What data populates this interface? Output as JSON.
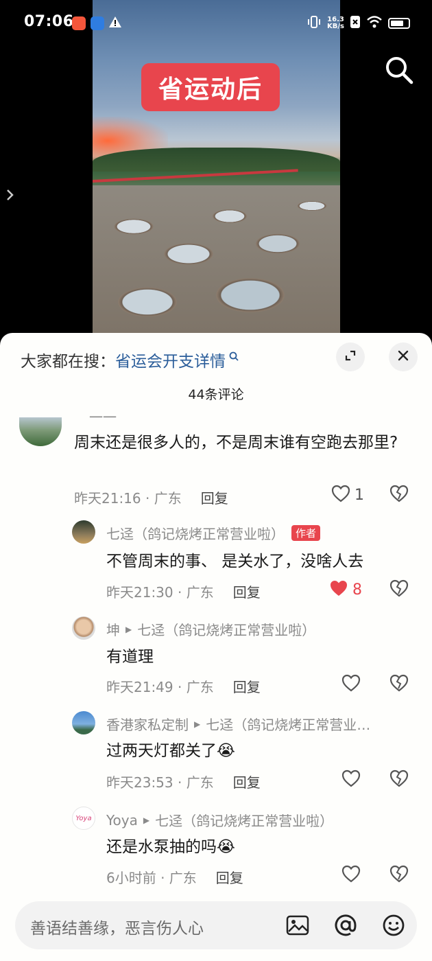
{
  "status_bar": {
    "time": "07:06",
    "net_speed_value": "16.3",
    "net_speed_unit": "KB/s"
  },
  "video": {
    "badge_text": "省运动后"
  },
  "comments_panel": {
    "hot_search_label": "大家都在搜：",
    "hot_search_term": "省运会开支详情",
    "count_label": "44条评论",
    "comments": [
      {
        "username": "一一",
        "text": "周末还是很多人的，不是周末谁有空跑去那里?",
        "time": "昨天21:16 · 广东",
        "reply_label": "回复",
        "likes": "1"
      }
    ],
    "replies": [
      {
        "username": "七迳（鸽记烧烤正常营业啦）",
        "author_tag": "作者",
        "text": "不管周末的事、 是关水了，没啥人去",
        "time": "昨天21:30 · 广东",
        "reply_label": "回复",
        "likes": "8"
      },
      {
        "username": "坤",
        "reply_to": "七迳（鸽记烧烤正常营业啦）",
        "text": "有道理",
        "time": "昨天21:49 · 广东",
        "reply_label": "回复"
      },
      {
        "username": "香港家私定制",
        "reply_to": "七迳（鸽记烧烤正常营业…",
        "text": "过两天灯都关了😭",
        "time": "昨天23:53 · 广东",
        "reply_label": "回复"
      },
      {
        "username": "Yoya",
        "reply_to": "七迳（鸽记烧烤正常营业啦）",
        "text": "还是水泵抽的吗😭",
        "time": "6小时前 · 广东",
        "reply_label": "回复"
      }
    ]
  },
  "input_bar": {
    "placeholder": "善语结善缘，恶言伤人心"
  },
  "colors": {
    "accent_red": "#e8454d",
    "link_blue": "#2a5d9a"
  }
}
